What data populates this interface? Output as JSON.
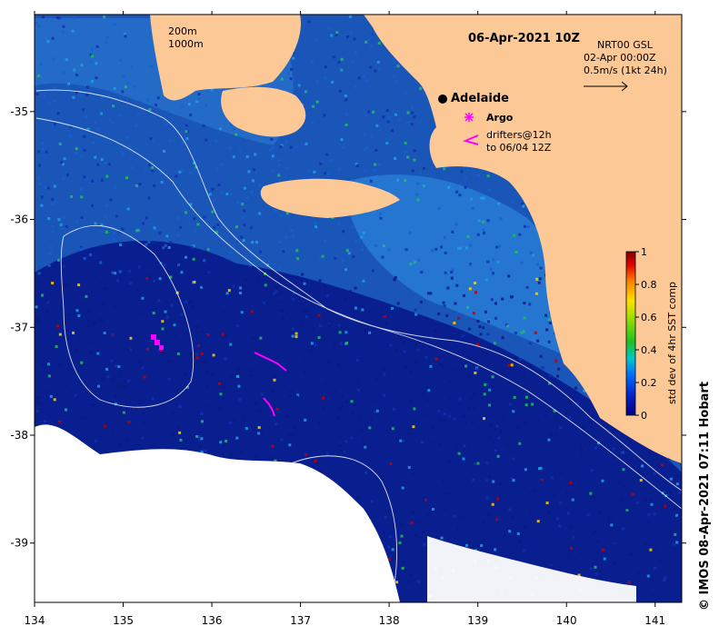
{
  "title": "06-Apr-2021 10Z",
  "depth_contours": [
    "200m",
    "1000m"
  ],
  "current_info": {
    "line1": "NRT00 GSL",
    "line2": "02-Apr 00:00Z",
    "scale": "0.5m/s (1kt 24h)"
  },
  "places": [
    {
      "name": "Adelaide",
      "lon": 138.6,
      "lat": -34.93
    }
  ],
  "legend": {
    "argo_label": "Argo",
    "drifters_line1": "drifters@12h",
    "drifters_line2": "to 06/04 12Z"
  },
  "colorbar": {
    "label": "std dev of 4hr SST comp",
    "ticks": [
      "0",
      "0.2",
      "0.4",
      "0.6",
      "0.8",
      "1"
    ]
  },
  "axes": {
    "lon_ticks": [
      134,
      135,
      136,
      137,
      138,
      139,
      140,
      141
    ],
    "lat_ticks": [
      -35,
      -36,
      -37,
      -38,
      -39
    ],
    "lon_range": [
      134,
      141.3
    ],
    "lat_range": [
      -39.55,
      -34.1
    ]
  },
  "credit": "© IMOS 08-Apr-2021 07:11 Hobart",
  "colors": {
    "land": "#fbc896",
    "ocean_low": "#0a1e8c",
    "ocean_mid": "#1f78d2",
    "cloud": "#ffffff",
    "argo": "#ff00ff",
    "drifter": "#ff00ff"
  }
}
